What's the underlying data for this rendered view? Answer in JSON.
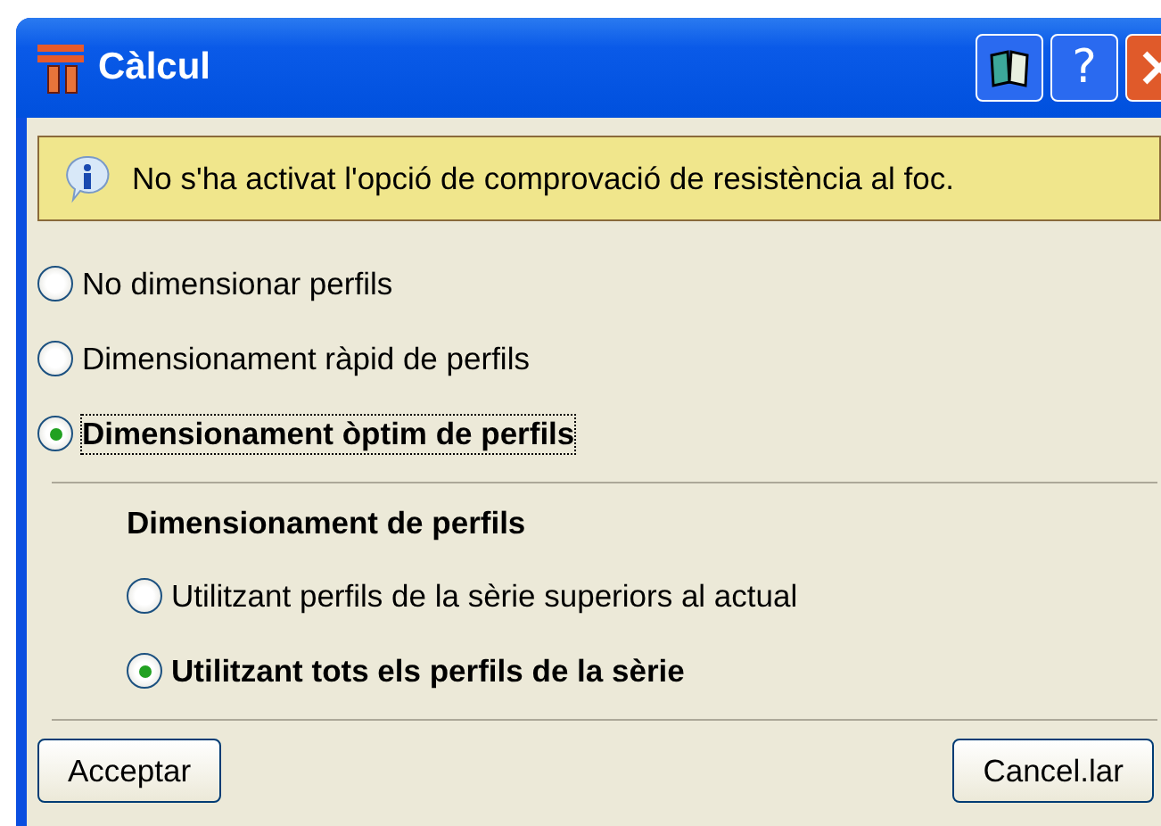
{
  "window": {
    "title": "Càlcul",
    "help_button": "?"
  },
  "info": {
    "text": "No s'ha activat l'opció de comprovació de resistència al foc."
  },
  "options": [
    {
      "label": "No dimensionar perfils",
      "selected": false
    },
    {
      "label": "Dimensionament ràpid de perfils",
      "selected": false
    },
    {
      "label": "Dimensionament òptim de perfils",
      "selected": true
    }
  ],
  "sizing": {
    "heading": "Dimensionament de perfils",
    "options": [
      {
        "label": "Utilitzant perfils de la sèrie superiors al actual",
        "selected": false
      },
      {
        "label": "Utilitzant tots els perfils de la sèrie",
        "selected": true
      }
    ]
  },
  "buttons": [
    {
      "label": "Acceptar"
    },
    {
      "label": "Cancel.lar"
    }
  ]
}
